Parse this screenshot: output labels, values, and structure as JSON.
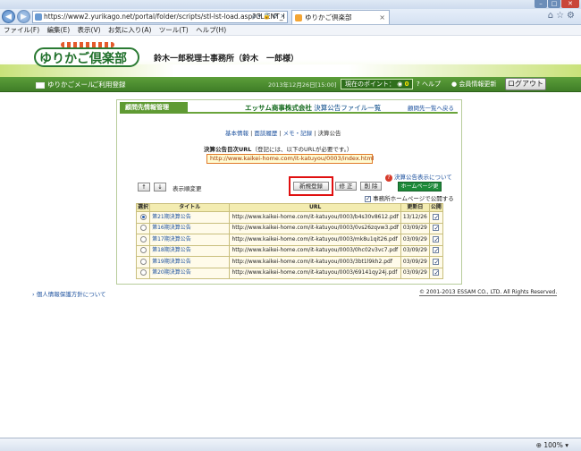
{
  "browser": {
    "url": "https://www2.yurikago.net/portal/folder/scripts/stl-lst-load.asp?CLIENT_I",
    "url_tools": "ρ ▾ 🔒 ⟳ ×",
    "tab_title": "ゆりかご倶楽部",
    "menu": [
      "ファイル(F)",
      "編集(E)",
      "表示(V)",
      "お気に入り(A)",
      "ツール(T)",
      "ヘルプ(H)"
    ],
    "zoom": "100%"
  },
  "header": {
    "logo_text": "ゆりかご倶楽部",
    "office_name": "鈴木一郎税理士事務所（鈴木　一郎様）"
  },
  "navbar": {
    "mail": "ゆりかごメール",
    "usage": "ご利用登録",
    "date_text": "2013年12月26日[15:00]",
    "points_label": "現在のポイント：",
    "points_value": "0",
    "help": "ヘルプ",
    "member_update": "会員情報更新",
    "logout": "ログアウト"
  },
  "section": {
    "title": "顧問先情報管理",
    "company": "エッサム商事株式会社",
    "company_suffix": "決算公告ファイル一覧",
    "back": "顧問先一覧へ戻る",
    "subnav": [
      "基本情報",
      "面談履歴",
      "メモ・記録",
      "決算公告"
    ]
  },
  "url_section": {
    "label": "決算公告目次URL",
    "note": "（登記には、以下のURLが必要です。）",
    "value": "http://www.kaikei-home.com/it-katuyou/0003/index.html"
  },
  "help_link": "決算公告表示について",
  "controls": {
    "up": "↑",
    "down": "↓",
    "sort_label": "表示順変更",
    "new": "新規登録",
    "edit": "修 正",
    "delete": "削 除",
    "hp_update": "ホームページ更新",
    "publish": "事務所ホームページで公開する"
  },
  "table": {
    "headers": [
      "選択",
      "タイトル",
      "URL",
      "更新日",
      "公開"
    ],
    "rows": [
      {
        "title": "第21期決算公告",
        "url": "http://www.kaikei-home.com/it-katuyou/0003/b4s30v8612.pdf",
        "date": "13/12/26",
        "selected": true
      },
      {
        "title": "第16期決算公告",
        "url": "http://www.kaikei-home.com/it-katuyou/0003/0vs26zqvw3.pdf",
        "date": "03/09/29",
        "selected": false
      },
      {
        "title": "第17期決算公告",
        "url": "http://www.kaikei-home.com/it-katuyou/0003/mk8u1qit26.pdf",
        "date": "03/09/29",
        "selected": false
      },
      {
        "title": "第18期決算公告",
        "url": "http://www.kaikei-home.com/it-katuyou/0003/0hc02v3vc7.pdf",
        "date": "03/09/29",
        "selected": false
      },
      {
        "title": "第19期決算公告",
        "url": "http://www.kaikei-home.com/it-katuyou/0003/3bt1l9kh2.pdf",
        "date": "03/09/29",
        "selected": false
      },
      {
        "title": "第20期決算公告",
        "url": "http://www.kaikei-home.com/it-katuyou/0003/69141qy24j.pdf",
        "date": "03/09/29",
        "selected": false
      }
    ]
  },
  "footer": {
    "privacy": "個人情報保護方針について",
    "copyright": "© 2001-2013 ESSAM CO., LTD. All Rights Reserved."
  },
  "colors": {
    "brand_green": "#3f7e27",
    "highlight_red": "#e01010",
    "table_header": "#f3ecb1"
  }
}
